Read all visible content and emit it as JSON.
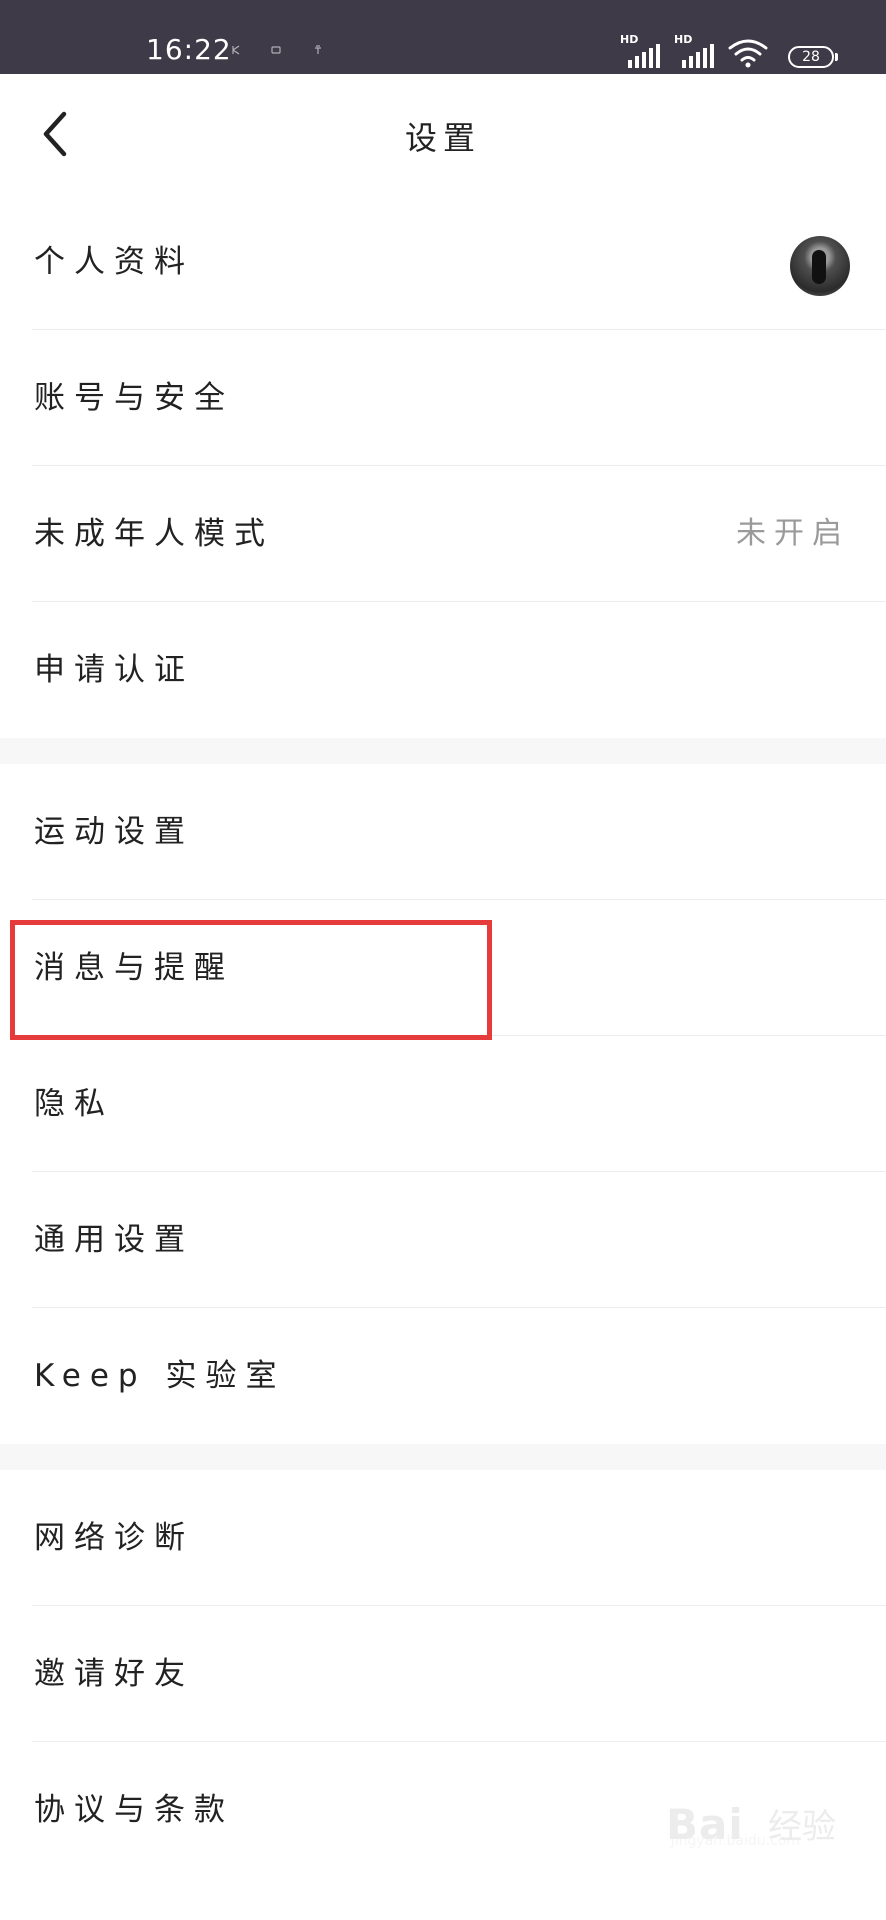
{
  "status_bar": {
    "time": "16:22",
    "signal_label": "HD",
    "battery": "28"
  },
  "header": {
    "title": "设置"
  },
  "sections": [
    {
      "items": [
        {
          "label": "个人资料",
          "has_avatar": true
        },
        {
          "label": "账号与安全"
        },
        {
          "label": "未成年人模式",
          "value": "未开启"
        },
        {
          "label": "申请认证"
        }
      ]
    },
    {
      "items": [
        {
          "label": "运动设置"
        },
        {
          "label": "消息与提醒",
          "highlighted": true
        },
        {
          "label": "隐私"
        },
        {
          "label": "通用设置"
        },
        {
          "label": "Keep 实验室"
        }
      ]
    },
    {
      "items": [
        {
          "label": "网络诊断"
        },
        {
          "label": "邀请好友"
        },
        {
          "label": "协议与条款"
        }
      ]
    }
  ],
  "watermark": {
    "brand": "Bai",
    "brand_cn": "经验",
    "site": "jingyan.baidu.com"
  },
  "colors": {
    "status_bar_bg": "#3f3a47",
    "highlight_border": "#e53b3b",
    "section_gap": "#f7f7f7",
    "divider": "#ececec",
    "value_text": "#9a9a9a"
  },
  "icons": {
    "back": "chevron-left-icon",
    "wifi": "wifi-icon",
    "battery": "battery-icon",
    "signal": "signal-icon"
  }
}
